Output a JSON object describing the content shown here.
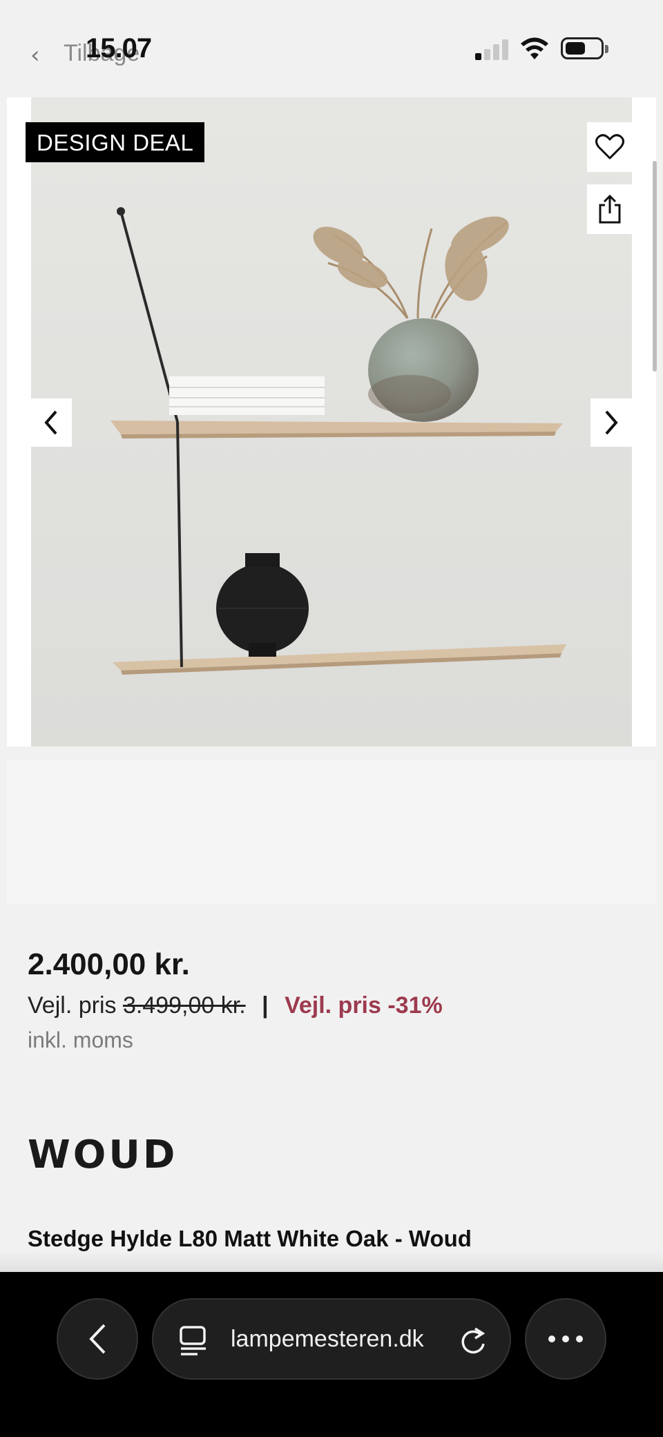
{
  "status_bar": {
    "back_label": "Tilbage",
    "time": "15.07"
  },
  "gallery": {
    "badge": "DESIGN DEAL",
    "icons": {
      "wishlist": "heart-icon",
      "share": "share-icon",
      "previous": "chevron-left-icon",
      "next": "chevron-right-icon"
    }
  },
  "product": {
    "price": "2.400,00 kr.",
    "reco_label": "Vejl. pris",
    "reco_price": "3.499,00 kr.",
    "separator": "|",
    "discount": "Vejl. pris -31%",
    "vat_note": "inkl. moms",
    "brand": "WOUD",
    "title": "Stedge Hylde L80 Matt White Oak - Woud"
  },
  "browser": {
    "url": "lampemesteren.dk"
  },
  "colors": {
    "discount": "#9c3a4e",
    "badge_bg": "#000000",
    "toolbar_bg": "#000000"
  }
}
